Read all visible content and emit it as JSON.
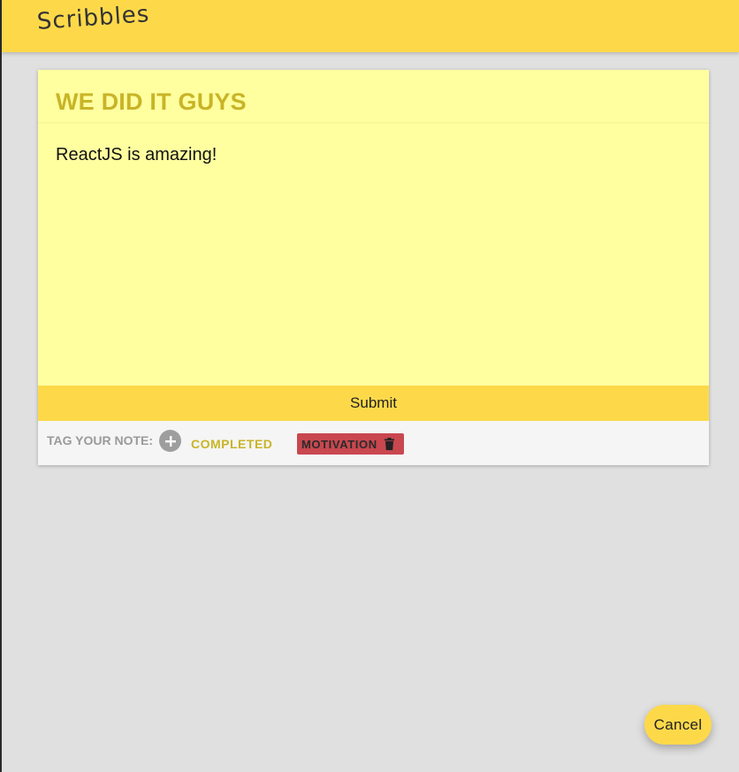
{
  "app": {
    "title": "Scribbles"
  },
  "note": {
    "title": "WE DID IT GUYS",
    "body": "ReactJS is amazing!",
    "submit_label": "Submit"
  },
  "tags": {
    "label": "TAG YOUR NOTE:",
    "add_icon": "plus-circle-icon",
    "items": [
      {
        "label": "COMPLETED",
        "selected": false,
        "color": "#c8b427"
      },
      {
        "label": "MOTIVATION",
        "selected": true,
        "color": "#c9474f",
        "delete_icon": "trash-icon"
      }
    ]
  },
  "actions": {
    "cancel_label": "Cancel"
  },
  "colors": {
    "accent": "#fdd94a",
    "note_background": "#ffffa0",
    "title_color": "#c8b427",
    "selected_tag": "#c9474f",
    "page_background": "#e0e0e0"
  }
}
